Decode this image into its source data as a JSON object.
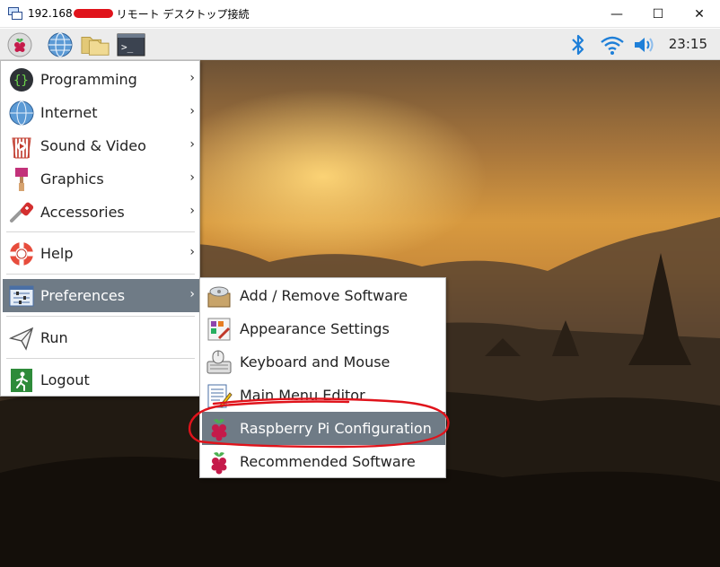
{
  "window": {
    "title_prefix": "192.168",
    "title_suffix": "リモート デスクトップ接続",
    "minimize": "—",
    "maximize": "☐",
    "close": "✕"
  },
  "panel": {
    "clock": "23:15",
    "icons": [
      "raspberry-icon",
      "web-browser-icon",
      "file-manager-icon",
      "terminal-icon",
      "bluetooth-icon",
      "wifi-icon",
      "volume-icon"
    ]
  },
  "menu": {
    "items": [
      {
        "label": "Programming",
        "icon": "programming-icon",
        "arrow": "›"
      },
      {
        "label": "Internet",
        "icon": "internet-icon",
        "arrow": "›"
      },
      {
        "label": "Sound & Video",
        "icon": "sound-video-icon",
        "arrow": "›"
      },
      {
        "label": "Graphics",
        "icon": "graphics-icon",
        "arrow": "›"
      },
      {
        "label": "Accessories",
        "icon": "accessories-icon",
        "arrow": "›"
      },
      {
        "label": "Help",
        "icon": "help-icon",
        "arrow": "›"
      },
      {
        "label": "Preferences",
        "icon": "preferences-icon",
        "arrow": "›"
      },
      {
        "label": "Run",
        "icon": "run-icon"
      },
      {
        "label": "Logout",
        "icon": "logout-icon"
      }
    ]
  },
  "submenu": {
    "items": [
      {
        "label": "Add / Remove Software",
        "icon": "add-remove-software-icon"
      },
      {
        "label": "Appearance Settings",
        "icon": "appearance-settings-icon"
      },
      {
        "label": "Keyboard and Mouse",
        "icon": "keyboard-mouse-icon"
      },
      {
        "label": "Main Menu Editor",
        "icon": "menu-editor-icon"
      },
      {
        "label": "Raspberry Pi Configuration",
        "icon": "raspberry-icon"
      },
      {
        "label": "Recommended Software",
        "icon": "raspberry-icon"
      }
    ]
  },
  "colors": {
    "selection": "#6f7b86",
    "annotation": "#e0131b",
    "accent_blue": "#1e7fd8"
  }
}
